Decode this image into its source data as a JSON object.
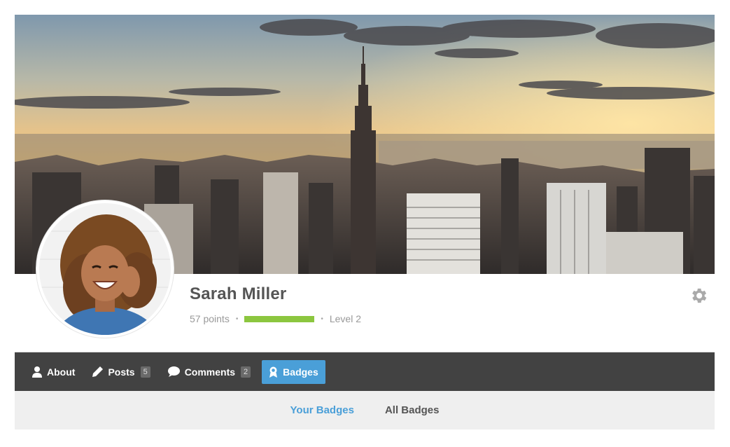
{
  "profile": {
    "name": "Sarah Miller",
    "points": "57 points",
    "level": "Level 2",
    "progress_fraction": 1.0
  },
  "nav": {
    "items": [
      {
        "label": "About",
        "icon": "user-icon"
      },
      {
        "label": "Posts",
        "icon": "pencil-icon",
        "count": "5"
      },
      {
        "label": "Comments",
        "icon": "comment-icon",
        "count": "2"
      },
      {
        "label": "Badges",
        "icon": "badge-icon",
        "active": true
      }
    ]
  },
  "subtabs": {
    "your_badges": "Your Badges",
    "all_badges": "All Badges"
  },
  "icons": {
    "settings": "gear-icon"
  },
  "colors": {
    "accent": "#4a9fd8",
    "nav_bg": "#424242",
    "progress": "#8cc63f"
  }
}
